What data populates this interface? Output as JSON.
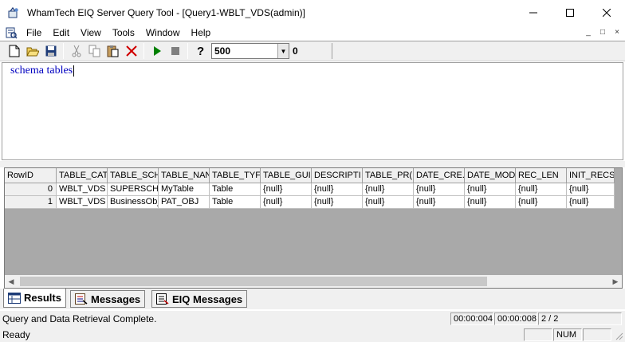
{
  "window": {
    "title": "WhamTech EIQ Server Query Tool - [Query1-WBLT_VDS(admin)]",
    "app_icon": "whamtech-app-icon",
    "controls": [
      "minimize",
      "maximize",
      "close"
    ]
  },
  "menu": {
    "items": [
      "File",
      "Edit",
      "View",
      "Tools",
      "Window",
      "Help"
    ],
    "mdi_controls": [
      "_",
      "□",
      "×"
    ]
  },
  "toolbar": {
    "row_limit": "500",
    "result_count": "0",
    "buttons": [
      "new-icon",
      "open-icon",
      "save-icon",
      "cut-icon",
      "copy-icon",
      "paste-icon",
      "delete-icon",
      "run-icon",
      "stop-icon",
      "help-icon"
    ]
  },
  "editor": {
    "text": "schema tables"
  },
  "grid": {
    "columns": [
      "RowID",
      "TABLE_CAT",
      "TABLE_SCH",
      "TABLE_NAN",
      "TABLE_TYF",
      "TABLE_GUI",
      "DESCRIPTI",
      "TABLE_PR(",
      "DATE_CRE.",
      "DATE_MOD",
      "REC_LEN",
      "INIT_RECS"
    ],
    "rows": [
      [
        "0",
        "WBLT_VDS",
        "SUPERSCH",
        "MyTable",
        "Table",
        "{null}",
        "{null}",
        "{null}",
        "{null}",
        "{null}",
        "{null}",
        "{null}"
      ],
      [
        "1",
        "WBLT_VDS",
        "BusinessObj",
        "PAT_OBJ",
        "Table",
        "{null}",
        "{null}",
        "{null}",
        "{null}",
        "{null}",
        "{null}",
        "{null}"
      ]
    ]
  },
  "tabs": [
    {
      "label": "Results",
      "icon": "results-icon",
      "active": true
    },
    {
      "label": "Messages",
      "icon": "messages-icon",
      "active": false
    },
    {
      "label": "EIQ Messages",
      "icon": "eiq-messages-icon",
      "active": false
    }
  ],
  "status": {
    "message": "Query and Data Retrieval Complete.",
    "elapsed1": "00:00:004",
    "elapsed2": "00:00:008",
    "page": "2 / 2",
    "ready": "Ready",
    "num": "NUM"
  },
  "colors": {
    "editor_text": "#0000c0",
    "grid_background": "#a9a9a9",
    "chrome": "#f0f0f0"
  }
}
